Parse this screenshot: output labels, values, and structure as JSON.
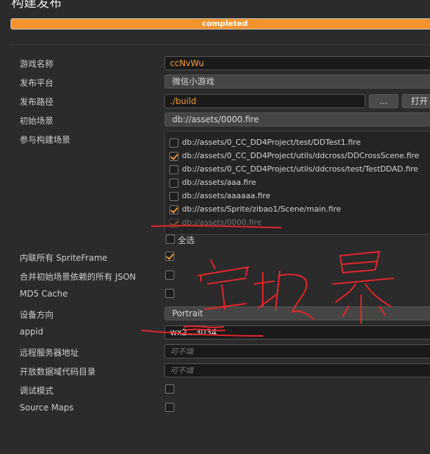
{
  "header": {
    "title": "构建发布",
    "progress_label": "completed"
  },
  "fields": {
    "game_name": {
      "label": "游戏名称",
      "value": "ccNvWu"
    },
    "platform": {
      "label": "发布平台",
      "value": "微信小游戏"
    },
    "build_path": {
      "label": "发布路径",
      "value": "./build",
      "browse_label": "...",
      "open_label": "打开"
    },
    "start_scene": {
      "label": "初始场景",
      "value": "db://assets/0000.fire"
    },
    "included_scenes": {
      "label": "参与构建场景",
      "items": [
        {
          "path": "db://assets/0_CC_DD4Project/test/DDTest1.fire",
          "checked": false
        },
        {
          "path": "db://assets/0_CC_DD4Project/utils/ddcross/DDCrossScene.fire",
          "checked": true
        },
        {
          "path": "db://assets/0_CC_DD4Project/utils/ddcross/test/TestDDAD.fire",
          "checked": false
        },
        {
          "path": "db://assets/aaa.fire",
          "checked": false
        },
        {
          "path": "db://assets/aaaaaa.fire",
          "checked": false
        },
        {
          "path": "db://assets/Sprite/zibao1/Scene/main.fire",
          "checked": true
        },
        {
          "path": "db://assets/0000.fire",
          "checked": true,
          "disabled": true
        }
      ],
      "select_all_label": "全选"
    },
    "inline_spriteframe": {
      "label": "内联所有 SpriteFrame",
      "checked": true
    },
    "merge_json": {
      "label": "合并初始场景依赖的所有 JSON",
      "checked": false
    },
    "md5_cache": {
      "label": "MD5 Cache",
      "checked": false
    },
    "orientation": {
      "label": "设备方向",
      "value": "Portrait"
    },
    "appid": {
      "label": "appid",
      "value": "wx2...3034"
    },
    "remote_server": {
      "label": "远程服务器地址",
      "placeholder": "可不填"
    },
    "open_data_dir": {
      "label": "开放数据域代码目录",
      "placeholder": "可不填"
    },
    "debug_mode": {
      "label": "调试模式",
      "checked": false
    },
    "source_maps": {
      "label": "Source Maps",
      "checked": false
    }
  },
  "colors": {
    "accent": "#f39a30",
    "annotation": "#e8262a",
    "background": "#2b2b2b"
  }
}
